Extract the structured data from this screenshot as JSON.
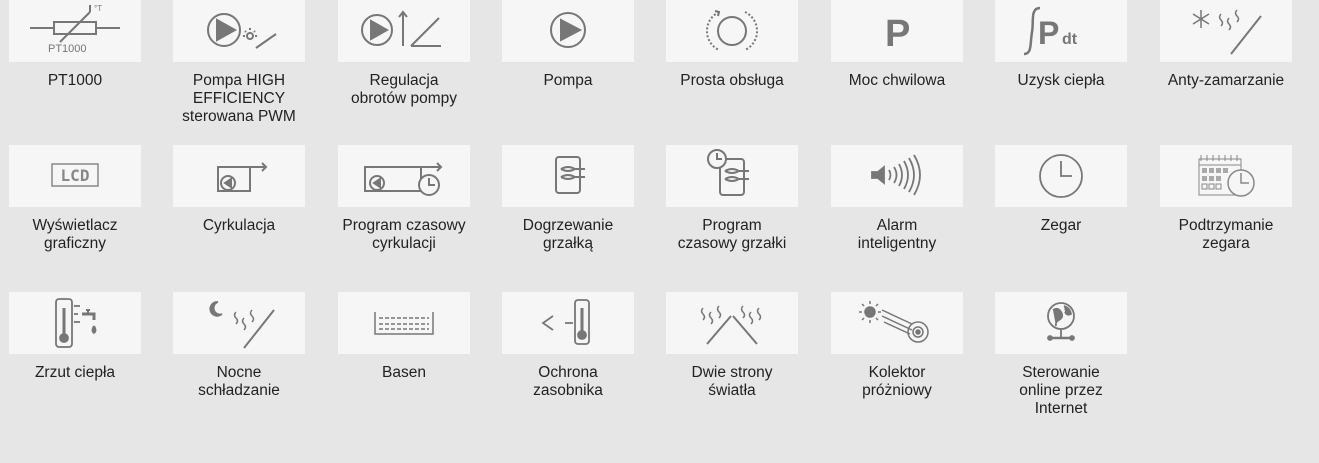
{
  "colors": {
    "background": "#e6e6e6",
    "tile": "#f6f6f6",
    "icon": "#777777",
    "text": "#222222"
  },
  "rows": [
    [
      {
        "icon": "thermistor-icon",
        "icon_text": "PT1000",
        "icon_sup": "°T",
        "lines": [
          "PT1000"
        ]
      },
      {
        "icon": "pump-high-efficiency-icon",
        "lines": [
          "Pompa HIGH",
          "EFFICIENCY",
          "sterowana  PWM"
        ]
      },
      {
        "icon": "pump-speed-regulation-icon",
        "lines": [
          "Regulacja",
          "obrotów pompy"
        ]
      },
      {
        "icon": "pump-icon",
        "lines": [
          "Pompa"
        ]
      },
      {
        "icon": "rotary-knob-icon",
        "lines": [
          "Prosta obsługa"
        ]
      },
      {
        "icon": "power-p-icon",
        "icon_text": "P",
        "lines": [
          "Moc chwilowa"
        ]
      },
      {
        "icon": "heat-gain-integral-icon",
        "icon_text": "P",
        "icon_sub": "dt",
        "lines": [
          "Uzysk ciepła"
        ]
      },
      {
        "icon": "anti-freeze-icon",
        "lines": [
          "Anty-zamarzanie"
        ]
      }
    ],
    [
      {
        "icon": "lcd-display-icon",
        "icon_text": "LCD",
        "lines": [
          "Wyświetlacz",
          "graficzny"
        ]
      },
      {
        "icon": "circulation-icon",
        "lines": [
          "Cyrkulacja"
        ]
      },
      {
        "icon": "circulation-timer-icon",
        "lines": [
          "Program czasowy",
          "cyrkulacji"
        ]
      },
      {
        "icon": "heater-tank-icon",
        "lines": [
          "Dogrzewanie",
          "grzałką"
        ]
      },
      {
        "icon": "heater-timer-icon",
        "lines": [
          "Program",
          "czasowy grzałki"
        ]
      },
      {
        "icon": "alarm-speaker-icon",
        "lines": [
          "Alarm",
          "inteligentny"
        ]
      },
      {
        "icon": "clock-icon",
        "lines": [
          "Zegar"
        ]
      },
      {
        "icon": "calendar-clock-icon",
        "lines": [
          "Podtrzymanie",
          "zegara"
        ]
      }
    ],
    [
      {
        "icon": "heat-dump-thermometer-icon",
        "lines": [
          "Zrzut ciepła"
        ]
      },
      {
        "icon": "night-cooling-icon",
        "lines": [
          "Nocne",
          "schładzanie"
        ]
      },
      {
        "icon": "pool-icon",
        "lines": [
          "Basen"
        ]
      },
      {
        "icon": "tank-protection-icon",
        "lines": [
          "Ochrona",
          "zasobnika"
        ]
      },
      {
        "icon": "two-sides-light-icon",
        "lines": [
          "Dwie strony",
          "światła"
        ]
      },
      {
        "icon": "vacuum-collector-icon",
        "lines": [
          "Kolektor",
          "próżniowy"
        ]
      },
      {
        "icon": "internet-globe-icon",
        "lines": [
          "Sterowanie",
          "online przez",
          "Internet"
        ]
      }
    ]
  ]
}
